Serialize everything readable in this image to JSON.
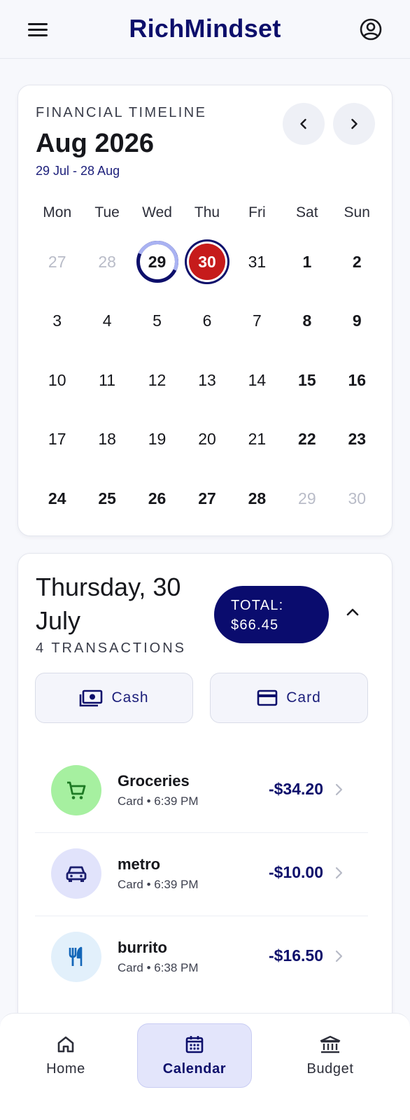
{
  "app": {
    "title": "RichMindset"
  },
  "calendar": {
    "eyebrow": "FINANCIAL TIMELINE",
    "month": "Aug 2026",
    "range": "29 Jul - 28 Aug",
    "weekdays": [
      "Mon",
      "Tue",
      "Wed",
      "Thu",
      "Fri",
      "Sat",
      "Sun"
    ],
    "days": [
      {
        "label": "27",
        "state": "muted"
      },
      {
        "label": "28",
        "state": "muted"
      },
      {
        "label": "29",
        "state": "today"
      },
      {
        "label": "30",
        "state": "selected"
      },
      {
        "label": "31",
        "state": ""
      },
      {
        "label": "1",
        "state": "bold"
      },
      {
        "label": "2",
        "state": "bold"
      },
      {
        "label": "3",
        "state": ""
      },
      {
        "label": "4",
        "state": ""
      },
      {
        "label": "5",
        "state": ""
      },
      {
        "label": "6",
        "state": ""
      },
      {
        "label": "7",
        "state": ""
      },
      {
        "label": "8",
        "state": "bold"
      },
      {
        "label": "9",
        "state": "bold"
      },
      {
        "label": "10",
        "state": ""
      },
      {
        "label": "11",
        "state": ""
      },
      {
        "label": "12",
        "state": ""
      },
      {
        "label": "13",
        "state": ""
      },
      {
        "label": "14",
        "state": ""
      },
      {
        "label": "15",
        "state": "bold"
      },
      {
        "label": "16",
        "state": "bold"
      },
      {
        "label": "17",
        "state": ""
      },
      {
        "label": "18",
        "state": ""
      },
      {
        "label": "19",
        "state": ""
      },
      {
        "label": "20",
        "state": ""
      },
      {
        "label": "21",
        "state": ""
      },
      {
        "label": "22",
        "state": "bold"
      },
      {
        "label": "23",
        "state": "bold"
      },
      {
        "label": "24",
        "state": "bold"
      },
      {
        "label": "25",
        "state": "bold"
      },
      {
        "label": "26",
        "state": "bold"
      },
      {
        "label": "27",
        "state": "bold"
      },
      {
        "label": "28",
        "state": "bold"
      },
      {
        "label": "29",
        "state": "muted"
      },
      {
        "label": "30",
        "state": "muted"
      }
    ]
  },
  "day_detail": {
    "title": "Thursday, 30 July",
    "count": "4 TRANSACTIONS",
    "total_label": "TOTAL:",
    "total_value": "$66.45",
    "cash_label": "Cash",
    "card_label": "Card"
  },
  "transactions": [
    {
      "name": "Groceries",
      "meta": "Card • 6:39 PM",
      "amount": "-$34.20",
      "icon": "cart-icon",
      "bg": "#a6f0a0",
      "fg": "#1e7a24"
    },
    {
      "name": "metro",
      "meta": "Card • 6:39 PM",
      "amount": "-$10.00",
      "icon": "car-icon",
      "bg": "#e1e3fb",
      "fg": "#1b1e6e"
    },
    {
      "name": "burrito",
      "meta": "Card • 6:38 PM",
      "amount": "-$16.50",
      "icon": "utensils-icon",
      "bg": "#e2f0fb",
      "fg": "#1366b8"
    }
  ],
  "nav": {
    "home": "Home",
    "calendar": "Calendar",
    "budget": "Budget"
  },
  "colors": {
    "brand": "#0d0f6b",
    "selected_day": "#c61b1b",
    "accent_light": "#e3e5fb"
  }
}
